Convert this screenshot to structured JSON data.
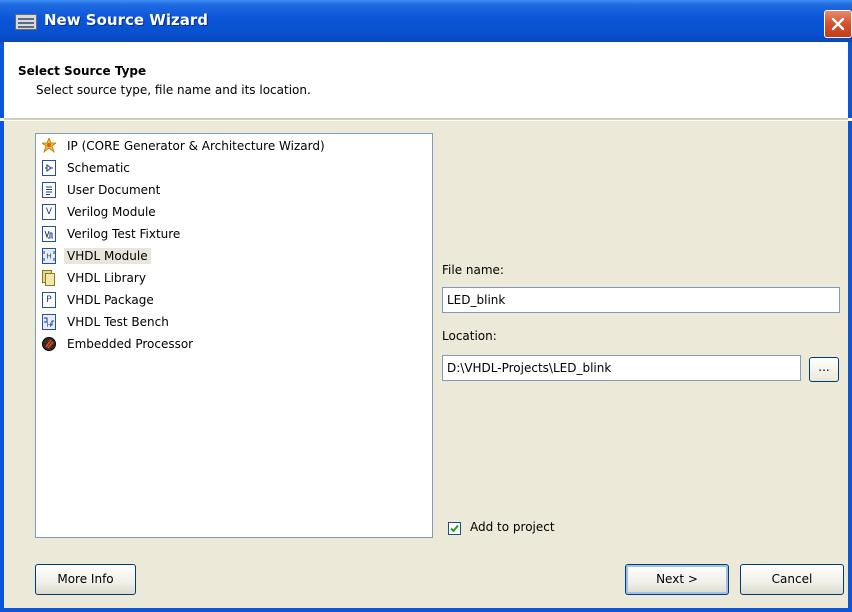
{
  "window": {
    "title": "New Source Wizard"
  },
  "header": {
    "title": "Select Source Type",
    "subtitle": "Select source type, file name and its location."
  },
  "source_types": [
    {
      "label": "IP (CORE Generator & Architecture Wizard)",
      "icon": "ip-core-icon"
    },
    {
      "label": "Schematic",
      "icon": "schematic-icon"
    },
    {
      "label": "User Document",
      "icon": "user-document-icon"
    },
    {
      "label": "Verilog Module",
      "icon": "verilog-module-icon"
    },
    {
      "label": "Verilog Test Fixture",
      "icon": "verilog-test-fixture-icon"
    },
    {
      "label": "VHDL Module",
      "icon": "vhdl-module-icon",
      "selected": true
    },
    {
      "label": "VHDL Library",
      "icon": "vhdl-library-icon"
    },
    {
      "label": "VHDL Package",
      "icon": "vhdl-package-icon"
    },
    {
      "label": "VHDL Test Bench",
      "icon": "vhdl-test-bench-icon"
    },
    {
      "label": "Embedded Processor",
      "icon": "embedded-processor-icon"
    }
  ],
  "file_name": {
    "label": "File name:",
    "value": "LED_blink"
  },
  "location": {
    "label": "Location:",
    "value": "D:\\VHDL-Projects\\LED_blink",
    "browse_label": "..."
  },
  "add_to_project": {
    "label": "Add to project",
    "checked": true
  },
  "buttons": {
    "more_info": "More Info",
    "next": "Next >",
    "cancel": "Cancel"
  }
}
